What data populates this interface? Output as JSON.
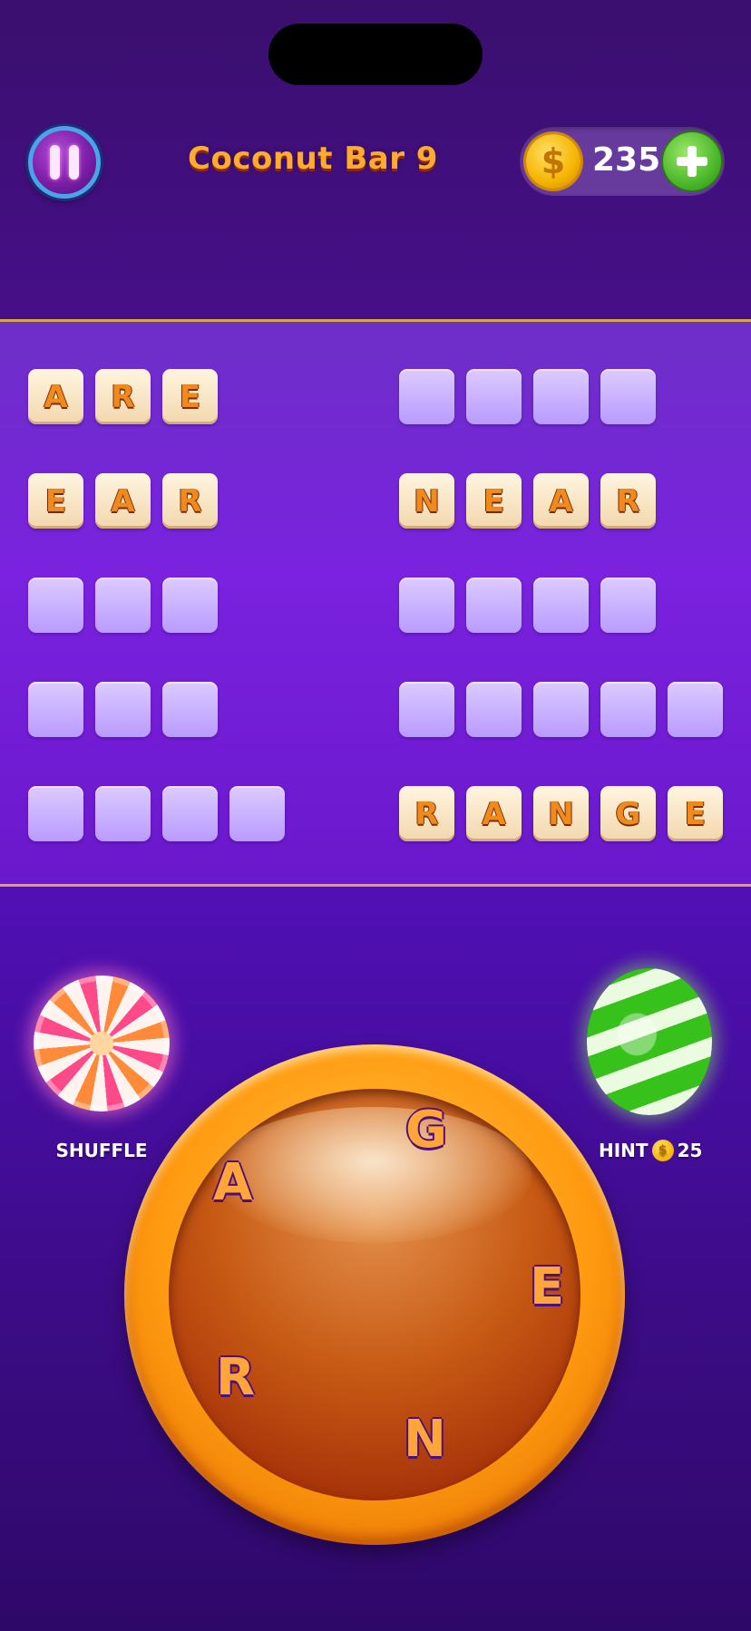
{
  "header": {
    "level_title": "Coconut Bar 9",
    "coins": "235",
    "coin_symbol": "$"
  },
  "board": {
    "left_column": [
      {
        "length": 3,
        "letters": [
          "A",
          "R",
          "E"
        ]
      },
      {
        "length": 3,
        "letters": [
          "E",
          "A",
          "R"
        ]
      },
      {
        "length": 3,
        "letters": [
          "",
          "",
          ""
        ]
      },
      {
        "length": 3,
        "letters": [
          "",
          "",
          ""
        ]
      },
      {
        "length": 4,
        "letters": [
          "",
          "",
          "",
          ""
        ]
      }
    ],
    "right_column": [
      {
        "length": 4,
        "letters": [
          "",
          "",
          "",
          ""
        ]
      },
      {
        "length": 4,
        "letters": [
          "N",
          "E",
          "A",
          "R"
        ]
      },
      {
        "length": 4,
        "letters": [
          "",
          "",
          "",
          ""
        ]
      },
      {
        "length": 5,
        "letters": [
          "",
          "",
          "",
          "",
          ""
        ]
      },
      {
        "length": 5,
        "letters": [
          "R",
          "A",
          "N",
          "G",
          "E"
        ]
      }
    ]
  },
  "powerups": {
    "shuffle_label": "SHUFFLE",
    "hint_label": "HINT",
    "hint_cost": "25",
    "coin_symbol": "$"
  },
  "wheel": {
    "letters": [
      "G",
      "A",
      "E",
      "R",
      "N"
    ]
  },
  "colors": {
    "tile_letter": "#f08a1a",
    "empty_tile": "#c9b2ff",
    "title": "#ffab2e"
  }
}
